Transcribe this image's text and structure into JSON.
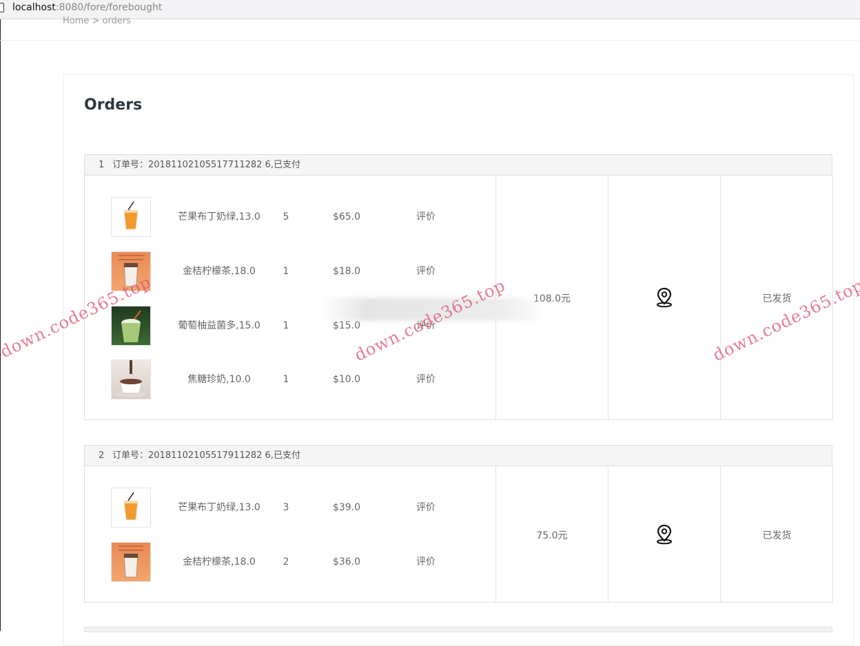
{
  "browser": {
    "url_host": "localhost",
    "url_rest": ":8080/fore/forebought"
  },
  "breadcrumb": {
    "home": "Home",
    "sep": ">",
    "current": "orders"
  },
  "page": {
    "title": "Orders"
  },
  "orders": [
    {
      "index": "1",
      "header": "订单号：20181102105517711282 6,已支付",
      "items": [
        {
          "image": "mango-drink",
          "name": "芒果布丁奶绿,13.0",
          "qty": "5",
          "price": "$65.0",
          "review": "评价"
        },
        {
          "image": "kumquat-tea",
          "name": "金桔柠檬茶,18.0",
          "qty": "1",
          "price": "$18.0",
          "review": "评价"
        },
        {
          "image": "grapefruit-drink",
          "name": "葡萄柚益菌多,15.0",
          "qty": "1",
          "price": "$15.0",
          "review": "评价"
        },
        {
          "image": "caramel-milk",
          "name": "焦糖珍奶,10.0",
          "qty": "1",
          "price": "$10.0",
          "review": "评价"
        }
      ],
      "total": "108.0元",
      "location_icon": "map-pin-icon",
      "status": "已发货"
    },
    {
      "index": "2",
      "header": "订单号：20181102105517911282 6,已支付",
      "items": [
        {
          "image": "mango-drink",
          "name": "芒果布丁奶绿,13.0",
          "qty": "3",
          "price": "$39.0",
          "review": "评价"
        },
        {
          "image": "kumquat-tea",
          "name": "金桔柠檬茶,18.0",
          "qty": "2",
          "price": "$36.0",
          "review": "评价"
        }
      ],
      "total": "75.0元",
      "location_icon": "map-pin-icon",
      "status": "已发货"
    }
  ],
  "watermarks": [
    "down.code365.top",
    "down.code365.top",
    "down.code365.top"
  ]
}
